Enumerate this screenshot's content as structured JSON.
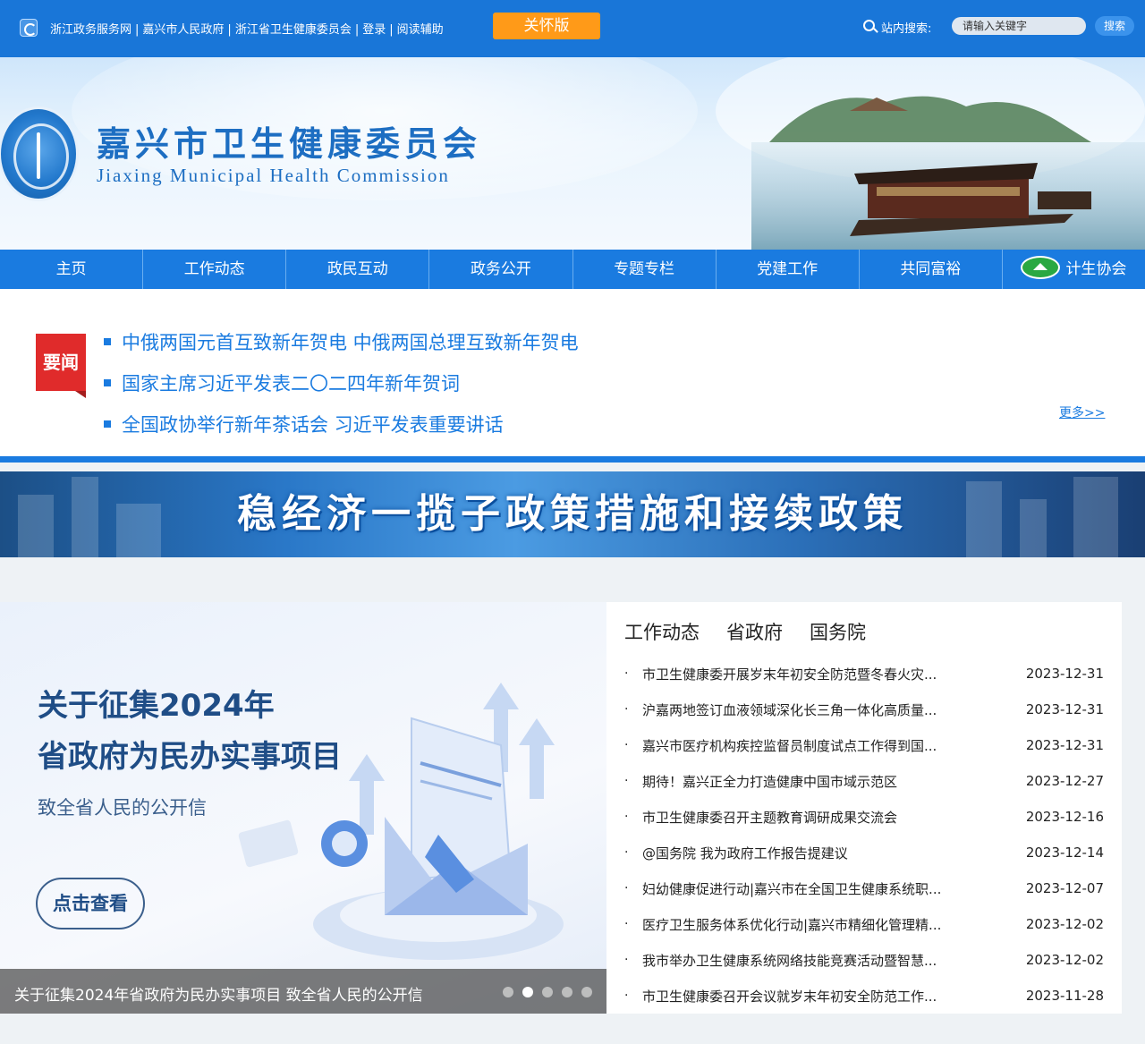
{
  "topbar": {
    "links": [
      "浙江政务服务网",
      "嘉兴市人民政府",
      "浙江省卫生健康委员会",
      "登录",
      "阅读辅助"
    ],
    "care_button": "关怀版",
    "search_label": "站内搜索:",
    "search_placeholder": "请输入关键字",
    "search_button": "搜索"
  },
  "header": {
    "title": "嘉兴市卫生健康委员会",
    "subtitle": "Jiaxing Municipal Health Commission"
  },
  "nav": {
    "items": [
      "主页",
      "工作动态",
      "政民互动",
      "政务公开",
      "专题专栏",
      "党建工作",
      "共同富裕",
      "计生协会"
    ]
  },
  "headlines": {
    "badge": "要闻",
    "items": [
      "中俄两国元首互致新年贺电 中俄两国总理互致新年贺电",
      "国家主席习近平发表二〇二四年新年贺词",
      "全国政协举行新年茶话会 习近平发表重要讲话"
    ],
    "more": "更多>>"
  },
  "policy_banner": {
    "text": "稳经济一揽子政策措施和接续政策"
  },
  "slider": {
    "title_line1": "关于征集2024年",
    "title_line2": "省政府为民办实事项目",
    "subtitle": "致全省人民的公开信",
    "button": "点击查看",
    "caption": "关于征集2024年省政府为民办实事项目 致全省人民的公开信",
    "active_dot": 2,
    "dot_count": 5
  },
  "news": {
    "tabs": [
      "工作动态",
      "省政府",
      "国务院"
    ],
    "items": [
      {
        "title": "市卫生健康委开展岁末年初安全防范暨冬春火灾...",
        "date": "2023-12-31"
      },
      {
        "title": "沪嘉两地签订血液领域深化长三角一体化高质量...",
        "date": "2023-12-31"
      },
      {
        "title": "嘉兴市医疗机构疾控监督员制度试点工作得到国...",
        "date": "2023-12-31"
      },
      {
        "title": "期待！嘉兴正全力打造健康中国市域示范区",
        "date": "2023-12-27"
      },
      {
        "title": "市卫生健康委召开主题教育调研成果交流会",
        "date": "2023-12-16"
      },
      {
        "title": "@国务院 我为政府工作报告提建议",
        "date": "2023-12-14"
      },
      {
        "title": "妇幼健康促进行动|嘉兴市在全国卫生健康系统职...",
        "date": "2023-12-07"
      },
      {
        "title": "医疗卫生服务体系优化行动|嘉兴市精细化管理精...",
        "date": "2023-12-02"
      },
      {
        "title": "我市举办卫生健康系统网络技能竞赛活动暨智慧...",
        "date": "2023-12-02"
      },
      {
        "title": "市卫生健康委召开会议就岁末年初安全防范工作...",
        "date": "2023-11-28"
      }
    ]
  }
}
